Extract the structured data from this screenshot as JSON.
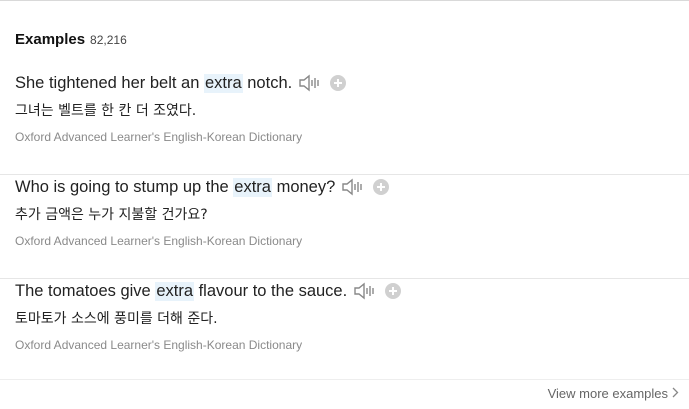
{
  "header": {
    "title": "Examples",
    "count": "82,216"
  },
  "examples": [
    {
      "en_before": "She tightened her belt an ",
      "en_highlight": "extra",
      "en_after": " notch.",
      "ko": "그녀는 벨트를 한 칸 더 조였다.",
      "source": "Oxford Advanced Learner's English-Korean Dictionary"
    },
    {
      "en_before": "Who is going to stump up the ",
      "en_highlight": "extra",
      "en_after": " money?",
      "ko": "추가 금액은 누가 지불할 건가요?",
      "source": "Oxford Advanced Learner's English-Korean Dictionary"
    },
    {
      "en_before": "The tomatoes give ",
      "en_highlight": "extra",
      "en_after": " flavour to the sauce.",
      "ko": "토마토가 소스에 풍미를 더해 준다.",
      "source": "Oxford Advanced Learner's English-Korean Dictionary"
    }
  ],
  "footer": {
    "view_more_label": "View more examples"
  },
  "icons": {
    "speaker": "speaker-icon",
    "add": "plus-circle-icon",
    "chevron": "chevron-right-icon"
  },
  "colors": {
    "highlight": "#e8f3fb",
    "source_text": "#8a8a8a",
    "icon_gray": "#d0d0d0"
  }
}
